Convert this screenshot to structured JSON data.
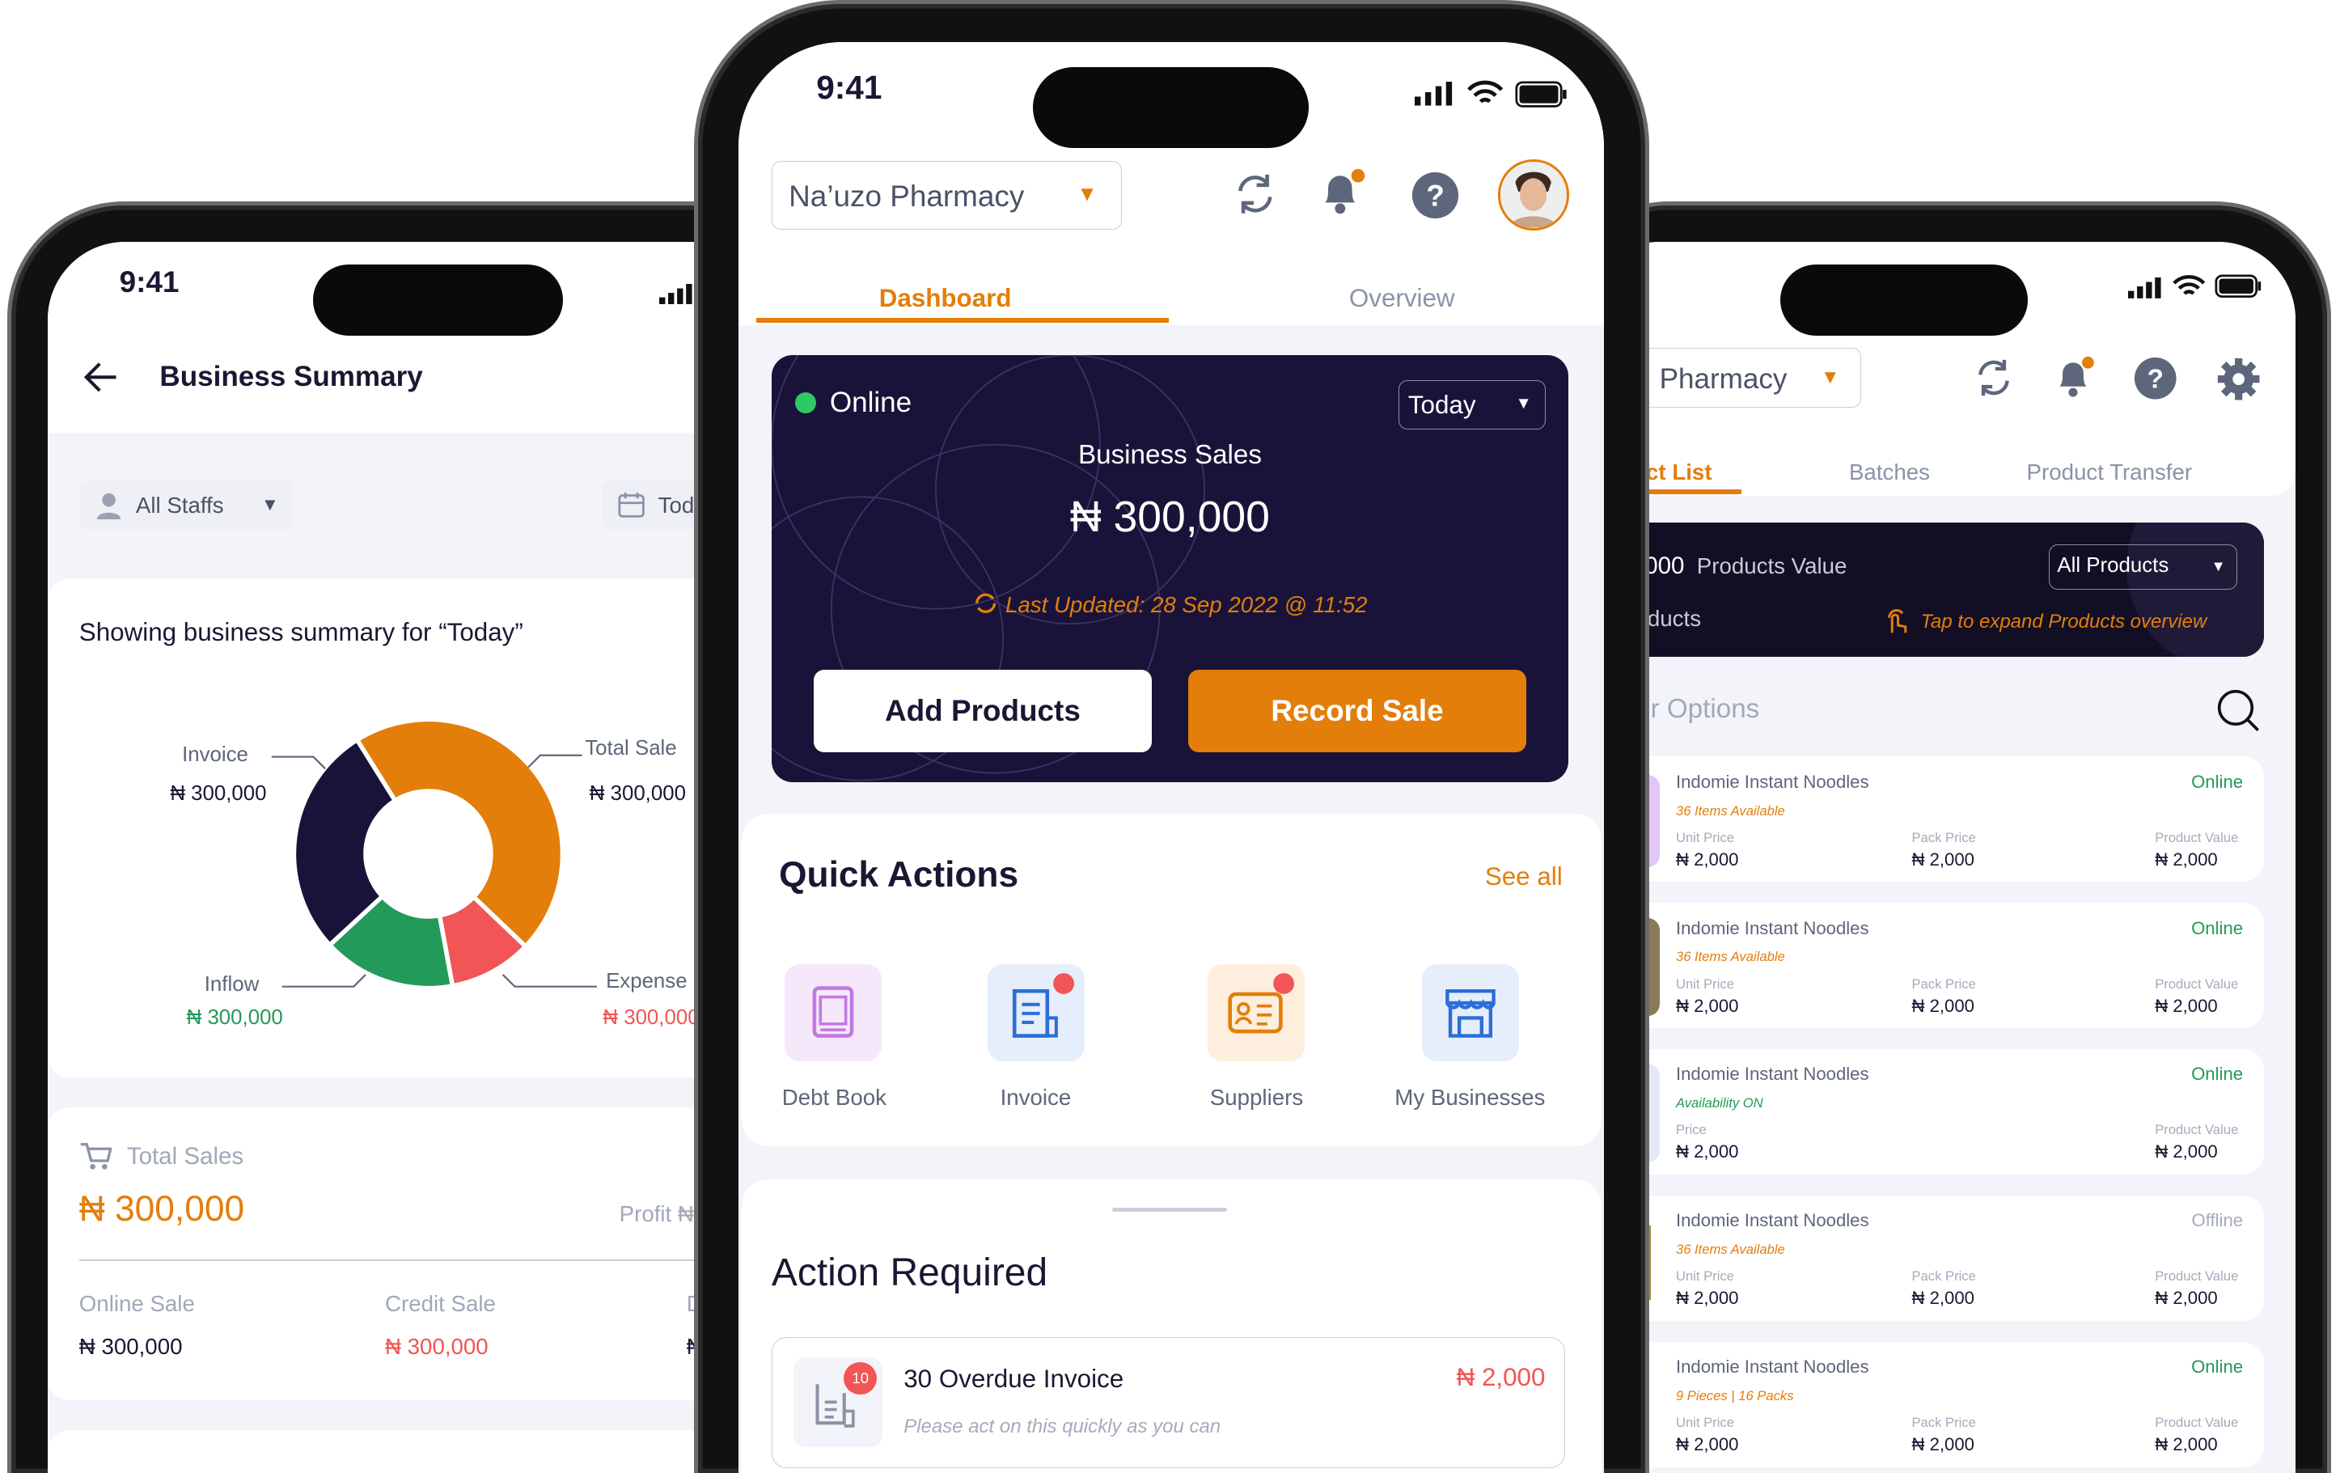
{
  "colors": {
    "accent": "#e37e0a",
    "navy": "#1a1339",
    "green": "#23995a",
    "red": "#f25555",
    "muted": "#8a93a6"
  },
  "left_phone": {
    "status_time": "9:41",
    "title": "Business Summary",
    "filters": {
      "staff": "All Staffs",
      "date": "Tod"
    },
    "summary_heading": "Showing business summary for “Today”",
    "total_sales": {
      "label": "Total Sales",
      "value": "₦ 300,000",
      "profit_label": "Profit ₦"
    },
    "breakdown": [
      {
        "label": "Online Sale",
        "value": "₦ 300,000"
      },
      {
        "label": "Credit Sale",
        "value": "₦ 300,000"
      },
      {
        "label": "D",
        "value": "₦"
      }
    ]
  },
  "chart_data": {
    "type": "pie",
    "variant": "donut",
    "slices": [
      {
        "label": "Total Sale",
        "value_label": "₦ 300,000",
        "share_percent": 46,
        "color": "#e37e0a"
      },
      {
        "label": "Expense",
        "value_label": "₦ 300,000",
        "share_percent": 10,
        "color": "#f25555"
      },
      {
        "label": "Inflow",
        "value_label": "₦ 300,000",
        "share_percent": 16,
        "color": "#23995a"
      },
      {
        "label": "Invoice",
        "value_label": "₦ 300,000",
        "share_percent": 28,
        "color": "#1a1339"
      }
    ]
  },
  "middle_phone": {
    "status_time": "9:41",
    "business": "Na’uzo Pharmacy",
    "tabs": [
      {
        "label": "Dashboard",
        "active": true
      },
      {
        "label": "Overview",
        "active": false
      }
    ],
    "sales_card": {
      "status": "Online",
      "period": "Today",
      "title": "Business Sales",
      "amount": "₦ 300,000",
      "last_updated": "Last Updated: 28 Sep 2022 @ 11:52",
      "add_button": "Add Products",
      "record_button": "Record Sale"
    },
    "quick_actions": {
      "title": "Quick Actions",
      "see_all": "See all",
      "items": [
        {
          "label": "Debt Book",
          "icon": "book-icon"
        },
        {
          "label": "Invoice",
          "icon": "invoice-icon"
        },
        {
          "label": "Suppliers",
          "icon": "supplier-card-icon"
        },
        {
          "label": "My Businesses",
          "icon": "store-icon"
        }
      ]
    },
    "action_required": {
      "title": "Action Required",
      "items": [
        {
          "badge": "10",
          "title": "30 Overdue Invoice",
          "amount": "₦ 2,000",
          "subtitle": "Please act on this quickly as you can"
        }
      ]
    }
  },
  "right_phone": {
    "business": "Pharmacy",
    "tabs": [
      {
        "label": "ct List",
        "active": true
      },
      {
        "label": "Batches",
        "active": false
      },
      {
        "label": "Product Transfer",
        "active": false
      }
    ],
    "value_card": {
      "amount_fragment": "000",
      "value_label": "Products Value",
      "filter": "All Products",
      "products_fragment": "ducts",
      "hint": "Tap to expand Products overview"
    },
    "filter_label": "r Options",
    "products": [
      {
        "name": "Indomie Instant Noodles",
        "status": "Online",
        "sub": "36 Items Available",
        "cols": [
          {
            "label": "Unit Price",
            "value": "₦ 2,000"
          },
          {
            "label": "Pack Price",
            "value": "₦ 2,000"
          },
          {
            "label": "Product Value",
            "value": "₦ 2,000"
          }
        ]
      },
      {
        "name": "Indomie Instant Noodles",
        "status": "Online",
        "sub": "36 Items Available",
        "cols": [
          {
            "label": "Unit Price",
            "value": "₦ 2,000"
          },
          {
            "label": "Pack Price",
            "value": "₦ 2,000"
          },
          {
            "label": "Product Value",
            "value": "₦ 2,000"
          }
        ]
      },
      {
        "name": "Indomie Instant Noodles",
        "status": "Online",
        "sub": "Availability ON",
        "cols": [
          {
            "label": "Price",
            "value": "₦ 2,000"
          },
          {
            "label": "Product Value",
            "value": "₦ 2,000"
          }
        ]
      },
      {
        "name": "Indomie Instant Noodles",
        "status": "Offline",
        "sub": "36 Items Available",
        "cols": [
          {
            "label": "Unit Price",
            "value": "₦ 2,000"
          },
          {
            "label": "Pack Price",
            "value": "₦ 2,000"
          },
          {
            "label": "Product Value",
            "value": "₦ 2,000"
          }
        ]
      },
      {
        "name": "Indomie Instant Noodles",
        "status": "Online",
        "sub": "9 Pieces | 16 Packs",
        "cols": [
          {
            "label": "Unit Price",
            "value": "₦ 2,000"
          },
          {
            "label": "Pack Price",
            "value": "₦ 2,000"
          },
          {
            "label": "Product Value",
            "value": "₦ 2,000"
          }
        ]
      }
    ]
  }
}
